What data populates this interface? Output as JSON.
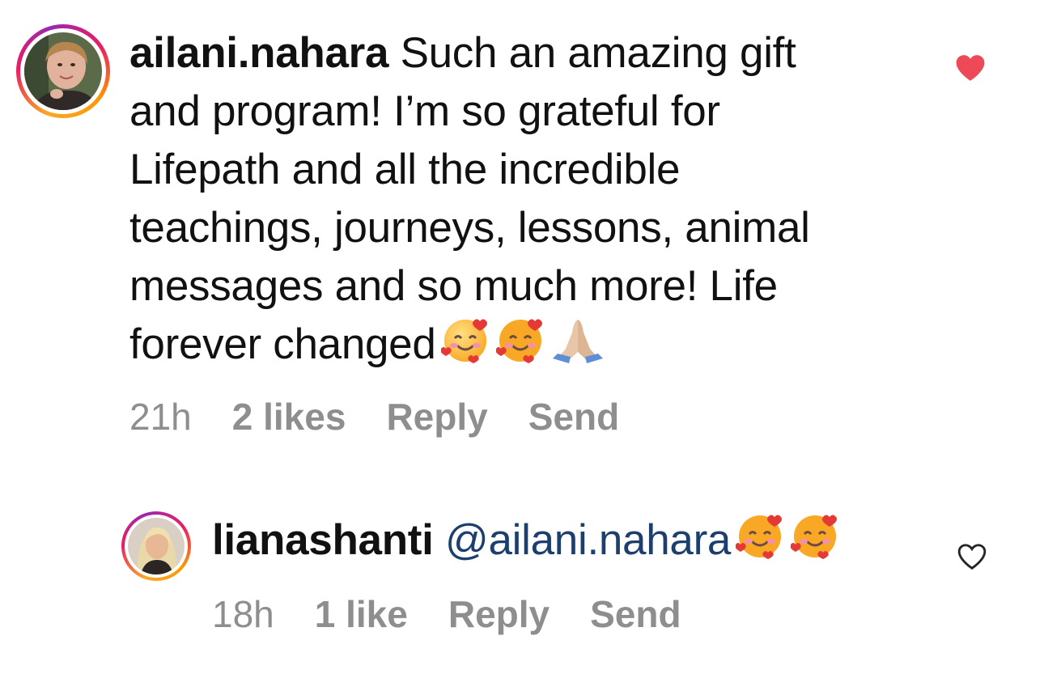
{
  "comments": [
    {
      "username": "ailani.nahara",
      "text_lines": [
        " Such an amazing gift",
        "and program! I’m so grateful for",
        "Lifepath and all the incredible",
        "teachings, journeys, lessons, animal",
        "messages and so much more! Life",
        "forever changed"
      ],
      "emojis": [
        "smiling-face-with-hearts",
        "smiling-face-with-hearts",
        "folded-hands"
      ],
      "time": "21h",
      "likes": "2 likes",
      "reply_label": "Reply",
      "send_label": "Send",
      "liked": true,
      "heart_color": "#ed4956"
    },
    {
      "username": "lianashanti",
      "mention": "@ailani.nahara",
      "emojis": [
        "smiling-face-with-hearts",
        "smiling-face-with-hearts"
      ],
      "time": "18h",
      "likes": "1 like",
      "reply_label": "Reply",
      "send_label": "Send",
      "liked": false
    }
  ],
  "colors": {
    "meta_text": "#8e8e8e",
    "mention_text": "#1d3f6e",
    "liked_heart": "#ed4956",
    "story_ring": [
      "#f9a825",
      "#e91e63",
      "#9c27b0"
    ]
  }
}
